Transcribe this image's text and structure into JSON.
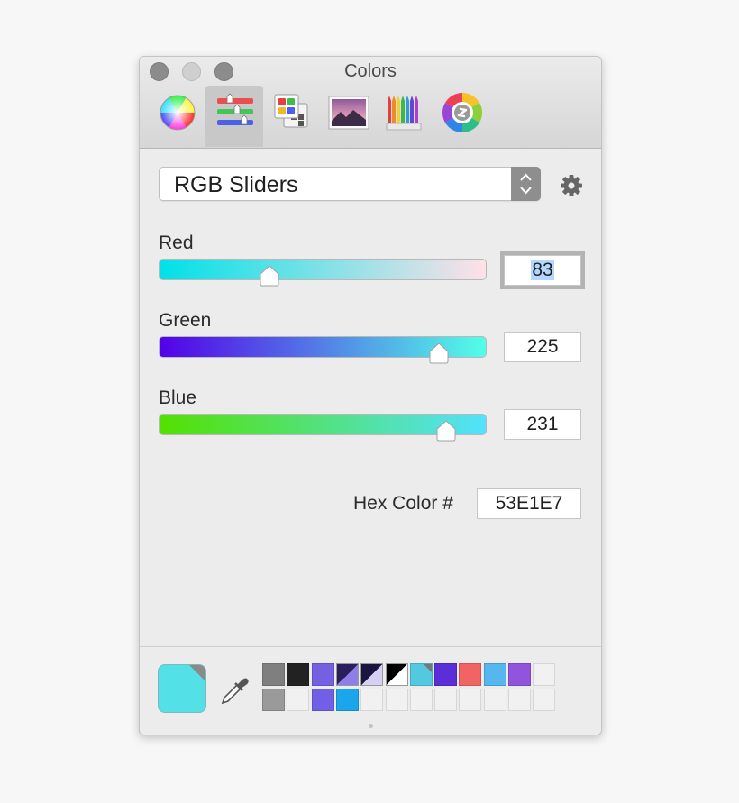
{
  "window": {
    "title": "Colors"
  },
  "toolbar": {
    "tabs": [
      {
        "name": "color-wheel",
        "selected": false
      },
      {
        "name": "color-sliders",
        "selected": true
      },
      {
        "name": "color-palettes",
        "selected": false
      },
      {
        "name": "image-palettes",
        "selected": false
      },
      {
        "name": "pencils",
        "selected": false
      },
      {
        "name": "spectrum-plugin",
        "selected": false
      }
    ]
  },
  "mode_select": {
    "value": "RGB Sliders"
  },
  "sliders": [
    {
      "label": "Red",
      "value": "83",
      "fraction": 0.325,
      "gradient": [
        "#00e1e7",
        "#ffe1e7"
      ],
      "focused": true
    },
    {
      "label": "Green",
      "value": "225",
      "fraction": 0.882,
      "gradient": [
        "#5300e7",
        "#53ffe7"
      ],
      "focused": false
    },
    {
      "label": "Blue",
      "value": "231",
      "fraction": 0.906,
      "gradient": [
        "#53e100",
        "#53e1ff"
      ],
      "focused": false
    }
  ],
  "hex": {
    "label": "Hex Color #",
    "value": "53E1E7"
  },
  "current_color": "#53e1e7",
  "swatches": {
    "row1": [
      {
        "color": "#7f7f7f"
      },
      {
        "color": "#222222"
      },
      {
        "color": "#7460e0"
      },
      {
        "split": [
          "#2a1e5c",
          "#8d7ee8"
        ]
      },
      {
        "split": [
          "#1a1640",
          "#d6d0f4"
        ]
      },
      {
        "split": [
          "#000000",
          "#ffffff"
        ]
      },
      {
        "color": "#53c9e0",
        "corner": true
      },
      {
        "color": "#5a2fd8"
      },
      {
        "color": "#f06464"
      },
      {
        "color": "#56b6ee"
      },
      {
        "color": "#9155dd"
      },
      {
        "color": ""
      }
    ],
    "row2": [
      {
        "color": "#9a9a9a"
      },
      {
        "color": ""
      },
      {
        "color": "#7060e8"
      },
      {
        "color": "#1ba6ec"
      },
      {
        "color": ""
      },
      {
        "color": ""
      },
      {
        "color": ""
      },
      {
        "color": ""
      },
      {
        "color": ""
      },
      {
        "color": ""
      },
      {
        "color": ""
      },
      {
        "color": ""
      }
    ]
  }
}
